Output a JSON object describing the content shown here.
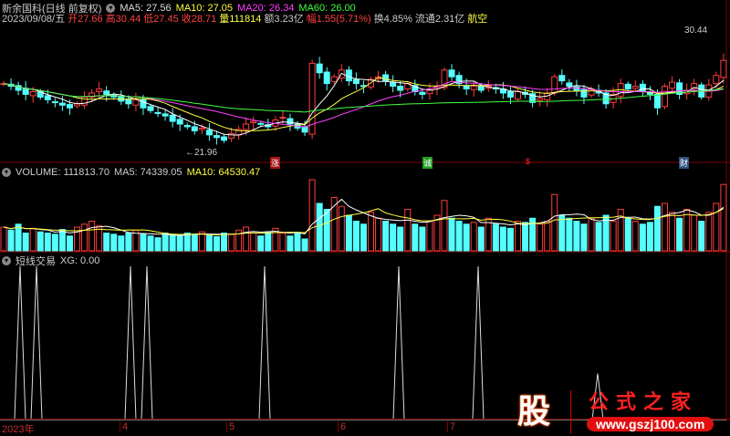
{
  "header": {
    "title": "新余国科(日线 前复权)",
    "ma5": "MA5: 27.56",
    "ma10": "MA10: 27.05",
    "ma20": "MA20: 26.34",
    "ma60": "MA60: 26.00"
  },
  "quote": {
    "date": "2023/09/08/五",
    "open": "开27.66",
    "high": "高30.44",
    "low": "低27.45",
    "close": "收28.71",
    "vol": "量111814",
    "amount": "额3.23亿",
    "change": "幅1.55(5.71%)",
    "turnover": "换4.85%",
    "float": "流通2.31亿",
    "sector": "航空"
  },
  "annotations": {
    "high": "30.44",
    "low": "←21.96"
  },
  "signals": [
    "涨",
    "诚",
    "$",
    "财"
  ],
  "volume_pane": {
    "label": "VOLUME: 111813.70",
    "ma5": "MA5: 74339.05",
    "ma10": "MA10: 64530.47"
  },
  "xg_pane": {
    "label": "短线交易",
    "value": "XG: 0.00"
  },
  "axis": [
    "2023年",
    "4",
    "5",
    "6",
    "7"
  ],
  "logo": {
    "char": "股",
    "name": "公式之家",
    "url": "www.gszj100.com"
  },
  "chart_data": {
    "type": "candlestick",
    "closes": [
      27.0,
      26.8,
      26.5,
      26.2,
      26.4,
      26.0,
      25.8,
      25.6,
      25.4,
      25.2,
      25.5,
      26.0,
      26.3,
      26.6,
      26.2,
      26.0,
      25.7,
      25.5,
      25.8,
      25.2,
      25.0,
      24.8,
      24.6,
      24.2,
      24.0,
      23.8,
      23.5,
      23.7,
      23.2,
      23.0,
      22.8,
      23.3,
      23.6,
      24.0,
      24.2,
      24.0,
      23.8,
      24.3,
      24.5,
      24.0,
      23.7,
      23.4,
      28.5,
      27.8,
      27.0,
      27.5,
      28.0,
      27.2,
      27.0,
      26.8,
      27.3,
      27.5,
      27.2,
      26.8,
      26.5,
      27.0,
      26.4,
      26.2,
      26.5,
      26.8,
      28.0,
      27.5,
      27.0,
      26.6,
      26.8,
      26.5,
      26.8,
      26.6,
      26.3,
      26.0,
      26.4,
      26.2,
      25.6,
      25.9,
      26.3,
      27.5,
      27.2,
      26.8,
      26.5,
      26.0,
      26.6,
      26.3,
      25.5,
      26.2,
      27.0,
      26.6,
      26.8,
      26.4,
      26.2,
      25.2,
      26.8,
      27.1,
      26.2,
      26.5,
      27.0,
      26.0,
      26.9,
      27.6,
      28.71
    ],
    "volumes": [
      40,
      35,
      45,
      30,
      38,
      32,
      30,
      28,
      36,
      25,
      40,
      45,
      50,
      42,
      30,
      28,
      25,
      30,
      35,
      28,
      25,
      22,
      30,
      28,
      25,
      30,
      28,
      32,
      26,
      24,
      30,
      28,
      35,
      40,
      30,
      25,
      32,
      38,
      30,
      25,
      30,
      20,
      120,
      80,
      70,
      90,
      75,
      60,
      50,
      45,
      65,
      55,
      50,
      45,
      40,
      70,
      45,
      40,
      50,
      60,
      85,
      55,
      50,
      45,
      48,
      40,
      55,
      45,
      40,
      38,
      50,
      48,
      55,
      45,
      50,
      95,
      60,
      55,
      50,
      45,
      55,
      48,
      60,
      50,
      70,
      55,
      50,
      45,
      48,
      75,
      80,
      65,
      55,
      70,
      60,
      50,
      65,
      80,
      112
    ],
    "xg_spikes": [
      {
        "bar": 2,
        "value": 1
      },
      {
        "bar": 4,
        "value": 1
      },
      {
        "bar": 17,
        "value": 1
      },
      {
        "bar": 19,
        "value": 1
      },
      {
        "bar": 35,
        "value": 1
      },
      {
        "bar": 54,
        "value": 1
      },
      {
        "bar": 65,
        "value": 1
      },
      {
        "bar": 81,
        "value": 0.3
      }
    ],
    "price_range": [
      21.5,
      31.5
    ]
  }
}
